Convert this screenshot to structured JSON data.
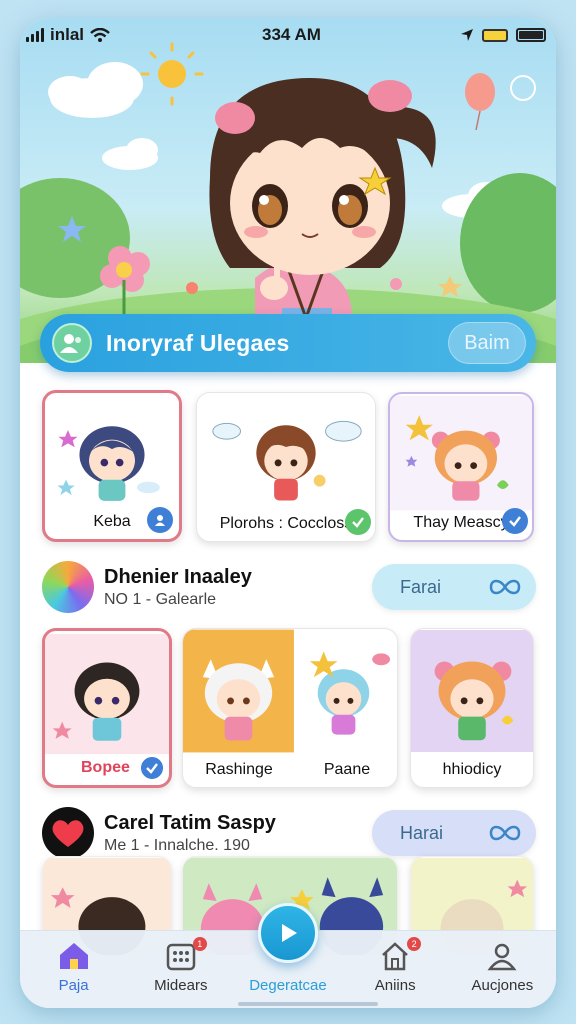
{
  "status": {
    "signal_text": "inlal",
    "time": "334 AM"
  },
  "header": {
    "title": "Inoryraf Ulegaes",
    "button_label": "Baim"
  },
  "row1": [
    {
      "label": "Keba",
      "check_color": "#3f7fd6",
      "border": "#e07a86"
    },
    {
      "label": "Plorohs : Cocclоss",
      "check_color": "#5cc46a",
      "border": "#e6e6e6"
    },
    {
      "label": "Thay Meascy",
      "check_color": "#3f7fd6",
      "border": "#c9b6e8"
    }
  ],
  "section1": {
    "title": "Dhenier Inaaley",
    "subtitle": "NO 1 - Galearle",
    "pill_label": "Farai",
    "pill_color": "#c8ecf7"
  },
  "row2": [
    {
      "label": "Bopee",
      "check_color": "#3f7fd6",
      "border": "#e07a86"
    },
    {
      "label": "Rashinge",
      "check_color": "",
      "border": "#e6e6e6"
    },
    {
      "label": "Paane",
      "check_color": "",
      "border": "#e6e6e6"
    },
    {
      "label": "hhiodicy",
      "check_color": "",
      "border": "#e6e6e6"
    }
  ],
  "section2": {
    "title": "Carel Tatim Saspy",
    "subtitle": "Me 1 - Innalche. 190",
    "pill_label": "Harai",
    "pill_color": "#d7def7"
  },
  "nav": [
    {
      "label": "Paja",
      "icon": "home-icon",
      "active": true
    },
    {
      "label": "Midears",
      "icon": "grid-icon",
      "badge": "1"
    },
    {
      "label": "Degeratcae",
      "icon": "play-icon"
    },
    {
      "label": "Aniins",
      "icon": "house-icon",
      "badge": "2"
    },
    {
      "label": "Aucjones",
      "icon": "user-icon"
    }
  ],
  "colors": {
    "accent": "#2aa1df",
    "active_tab": "#3a73d8"
  }
}
